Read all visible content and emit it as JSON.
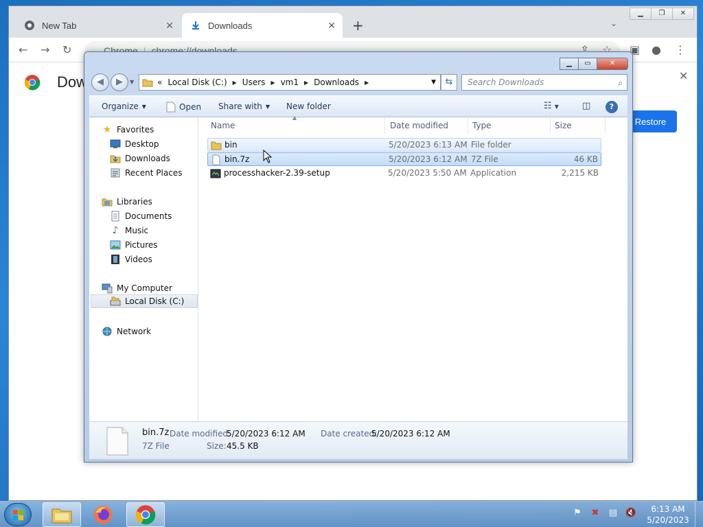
{
  "chrome": {
    "tabs": [
      {
        "label": "New Tab",
        "close": "✕"
      },
      {
        "label": "Downloads",
        "close": "✕"
      }
    ],
    "new_tab": "+",
    "omnibox_site": "Chrome",
    "omnibox_url": "chrome://downloads",
    "page_title": "Dow",
    "restore_label": "Restore",
    "window_buttons": [
      "▁",
      "❐",
      "✕"
    ]
  },
  "explorer": {
    "caption_buttons": [
      "▁",
      "▭",
      "✕"
    ],
    "address": {
      "prefix": "«",
      "segments": [
        "Local Disk (C:)",
        "Users",
        "vm1",
        "Downloads"
      ]
    },
    "search_placeholder": "Search Downloads",
    "commands": {
      "organize": "Organize",
      "open": "Open",
      "share_with": "Share with",
      "new_folder": "New folder"
    },
    "nav": {
      "favorites": {
        "label": "Favorites",
        "items": [
          "Desktop",
          "Downloads",
          "Recent Places"
        ]
      },
      "libraries": {
        "label": "Libraries",
        "items": [
          "Documents",
          "Music",
          "Pictures",
          "Videos"
        ]
      },
      "computer": {
        "label": "My Computer",
        "items": [
          "Local Disk (C:)"
        ]
      },
      "network": {
        "label": "Network"
      }
    },
    "columns": {
      "name": "Name",
      "date": "Date modified",
      "type": "Type",
      "size": "Size"
    },
    "files": [
      {
        "name": "bin",
        "date": "5/20/2023 6:13 AM",
        "type": "File folder",
        "size": "",
        "icon": "folder-icon"
      },
      {
        "name": "bin.7z",
        "date": "5/20/2023 6:12 AM",
        "type": "7Z File",
        "size": "46 KB",
        "icon": "file-icon"
      },
      {
        "name": "processhacker-2.39-setup",
        "date": "5/20/2023 5:50 AM",
        "type": "Application",
        "size": "2,215 KB",
        "icon": "application-icon"
      }
    ],
    "details": {
      "name": "bin.7z",
      "type": "7Z File",
      "date_modified_label": "Date modified:",
      "date_modified": "5/20/2023 6:12 AM",
      "date_created_label": "Date created:",
      "date_created": "5/20/2023 6:12 AM",
      "size_label": "Size:",
      "size": "45.5 KB"
    }
  },
  "taskbar": {
    "time": "6:13 AM",
    "date": "5/20/2023",
    "apps": [
      "file-explorer-icon",
      "firefox-icon",
      "chrome-icon"
    ]
  },
  "colors": {
    "chrome_blue": "#1a73e8",
    "selection": "#c4dcf8",
    "taskbar": "#7aa0c8"
  }
}
